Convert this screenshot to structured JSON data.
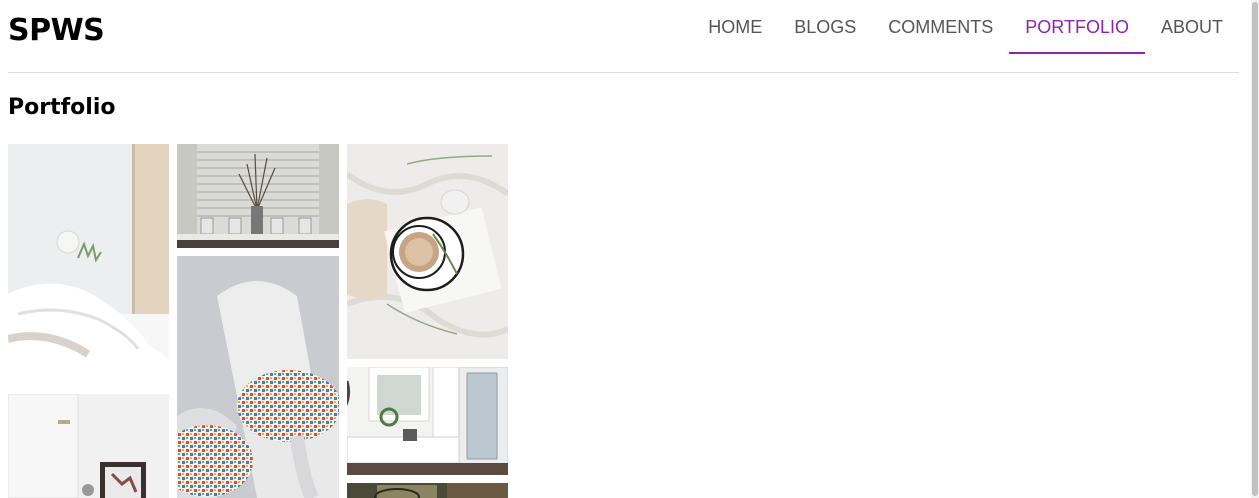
{
  "site": {
    "brand": "SPWS"
  },
  "nav": {
    "items": [
      {
        "label": "HOME",
        "active": false
      },
      {
        "label": "BLOGS",
        "active": false
      },
      {
        "label": "COMMENTS",
        "active": false
      },
      {
        "label": "PORTFOLIO",
        "active": true
      },
      {
        "label": "ABOUT",
        "active": false
      }
    ]
  },
  "page": {
    "title": "Portfolio"
  },
  "gallery": {
    "photos": [
      {
        "name": "white-bedroom-photo"
      },
      {
        "name": "white-door-frame-photo"
      },
      {
        "name": "window-blinds-vase-photo"
      },
      {
        "name": "white-chair-cushion-photo"
      },
      {
        "name": "coffee-on-bedsheet-photo"
      },
      {
        "name": "entryway-bench-photo"
      },
      {
        "name": "eyeglasses-photo"
      }
    ]
  },
  "colors": {
    "accent": "#8e24aa",
    "nav_text": "#555555",
    "divider": "#dcdcdc"
  }
}
